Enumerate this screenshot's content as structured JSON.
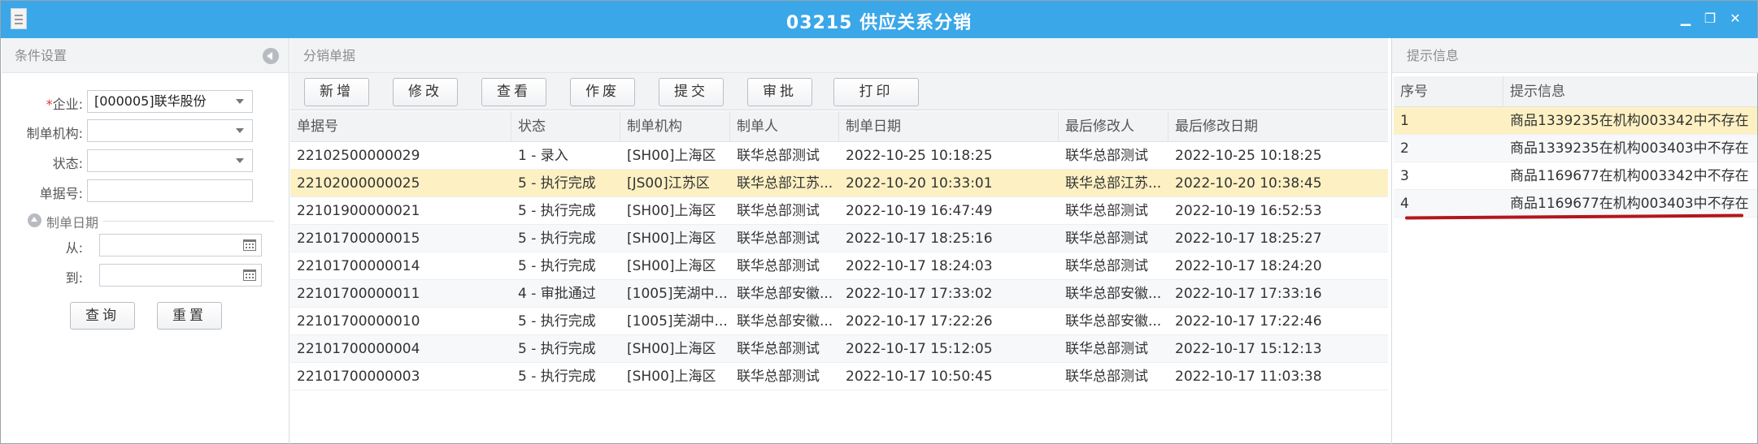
{
  "window": {
    "title": "03215 供应关系分销",
    "min_icon": "minimize-icon",
    "max_icon": "restore-icon",
    "close_icon": "close-icon"
  },
  "left_panel": {
    "header": "条件设置",
    "enterprise_label": "企业:",
    "enterprise_value": "[000005]联华股份",
    "org_label": "制单机构:",
    "org_value": "",
    "status_label": "状态:",
    "status_value": "",
    "docno_label": "单据号:",
    "docno_value": "",
    "date_section_label": "制单日期",
    "from_label": "从:",
    "to_label": "到:",
    "query_button": "查询",
    "reset_button": "重置"
  },
  "center_panel": {
    "header": "分销单据",
    "toolbar": {
      "new": "新增",
      "edit": "修改",
      "view": "查看",
      "void": "作废",
      "submit": "提交",
      "approve": "审批",
      "print": "打印"
    },
    "columns": [
      "单据号",
      "状态",
      "制单机构",
      "制单人",
      "制单日期",
      "最后修改人",
      "最后修改日期"
    ],
    "rows": [
      [
        "22102500000029",
        "1 - 录入",
        "[SH00]上海区",
        "联华总部测试",
        "2022-10-25 10:18:25",
        "联华总部测试",
        "2022-10-25 10:18:25"
      ],
      [
        "22102000000025",
        "5 - 执行完成",
        "[JS00]江苏区",
        "联华总部江苏...",
        "2022-10-20 10:33:01",
        "联华总部江苏...",
        "2022-10-20 10:38:45"
      ],
      [
        "22101900000021",
        "5 - 执行完成",
        "[SH00]上海区",
        "联华总部测试",
        "2022-10-19 16:47:49",
        "联华总部测试",
        "2022-10-19 16:52:53"
      ],
      [
        "22101700000015",
        "5 - 执行完成",
        "[SH00]上海区",
        "联华总部测试",
        "2022-10-17 18:25:16",
        "联华总部测试",
        "2022-10-17 18:25:27"
      ],
      [
        "22101700000014",
        "5 - 执行完成",
        "[SH00]上海区",
        "联华总部测试",
        "2022-10-17 18:24:03",
        "联华总部测试",
        "2022-10-17 18:24:20"
      ],
      [
        "22101700000011",
        "4 - 审批通过",
        "[1005]芜湖中...",
        "联华总部安徽...",
        "2022-10-17 17:33:02",
        "联华总部安徽...",
        "2022-10-17 17:33:16"
      ],
      [
        "22101700000010",
        "5 - 执行完成",
        "[1005]芜湖中...",
        "联华总部安徽...",
        "2022-10-17 17:22:26",
        "联华总部安徽...",
        "2022-10-17 17:22:46"
      ],
      [
        "22101700000004",
        "5 - 执行完成",
        "[SH00]上海区",
        "联华总部测试",
        "2022-10-17 15:12:05",
        "联华总部测试",
        "2022-10-17 15:12:13"
      ],
      [
        "22101700000003",
        "5 - 执行完成",
        "[SH00]上海区",
        "联华总部测试",
        "2022-10-17 10:50:45",
        "联华总部测试",
        "2022-10-17 11:03:38"
      ]
    ]
  },
  "right_panel": {
    "header": "提示信息",
    "columns": [
      "序号",
      "提示信息"
    ],
    "rows": [
      [
        "1",
        "商品1339235在机构003342中不存在"
      ],
      [
        "2",
        "商品1339235在机构003403中不存在"
      ],
      [
        "3",
        "商品1169677在机构003342中不存在"
      ],
      [
        "4",
        "商品1169677在机构003403中不存在"
      ]
    ]
  },
  "colors": {
    "titlebar": "#3aa7e8",
    "selected_row": "#fdf1c3",
    "annotation": "#b3161d"
  }
}
